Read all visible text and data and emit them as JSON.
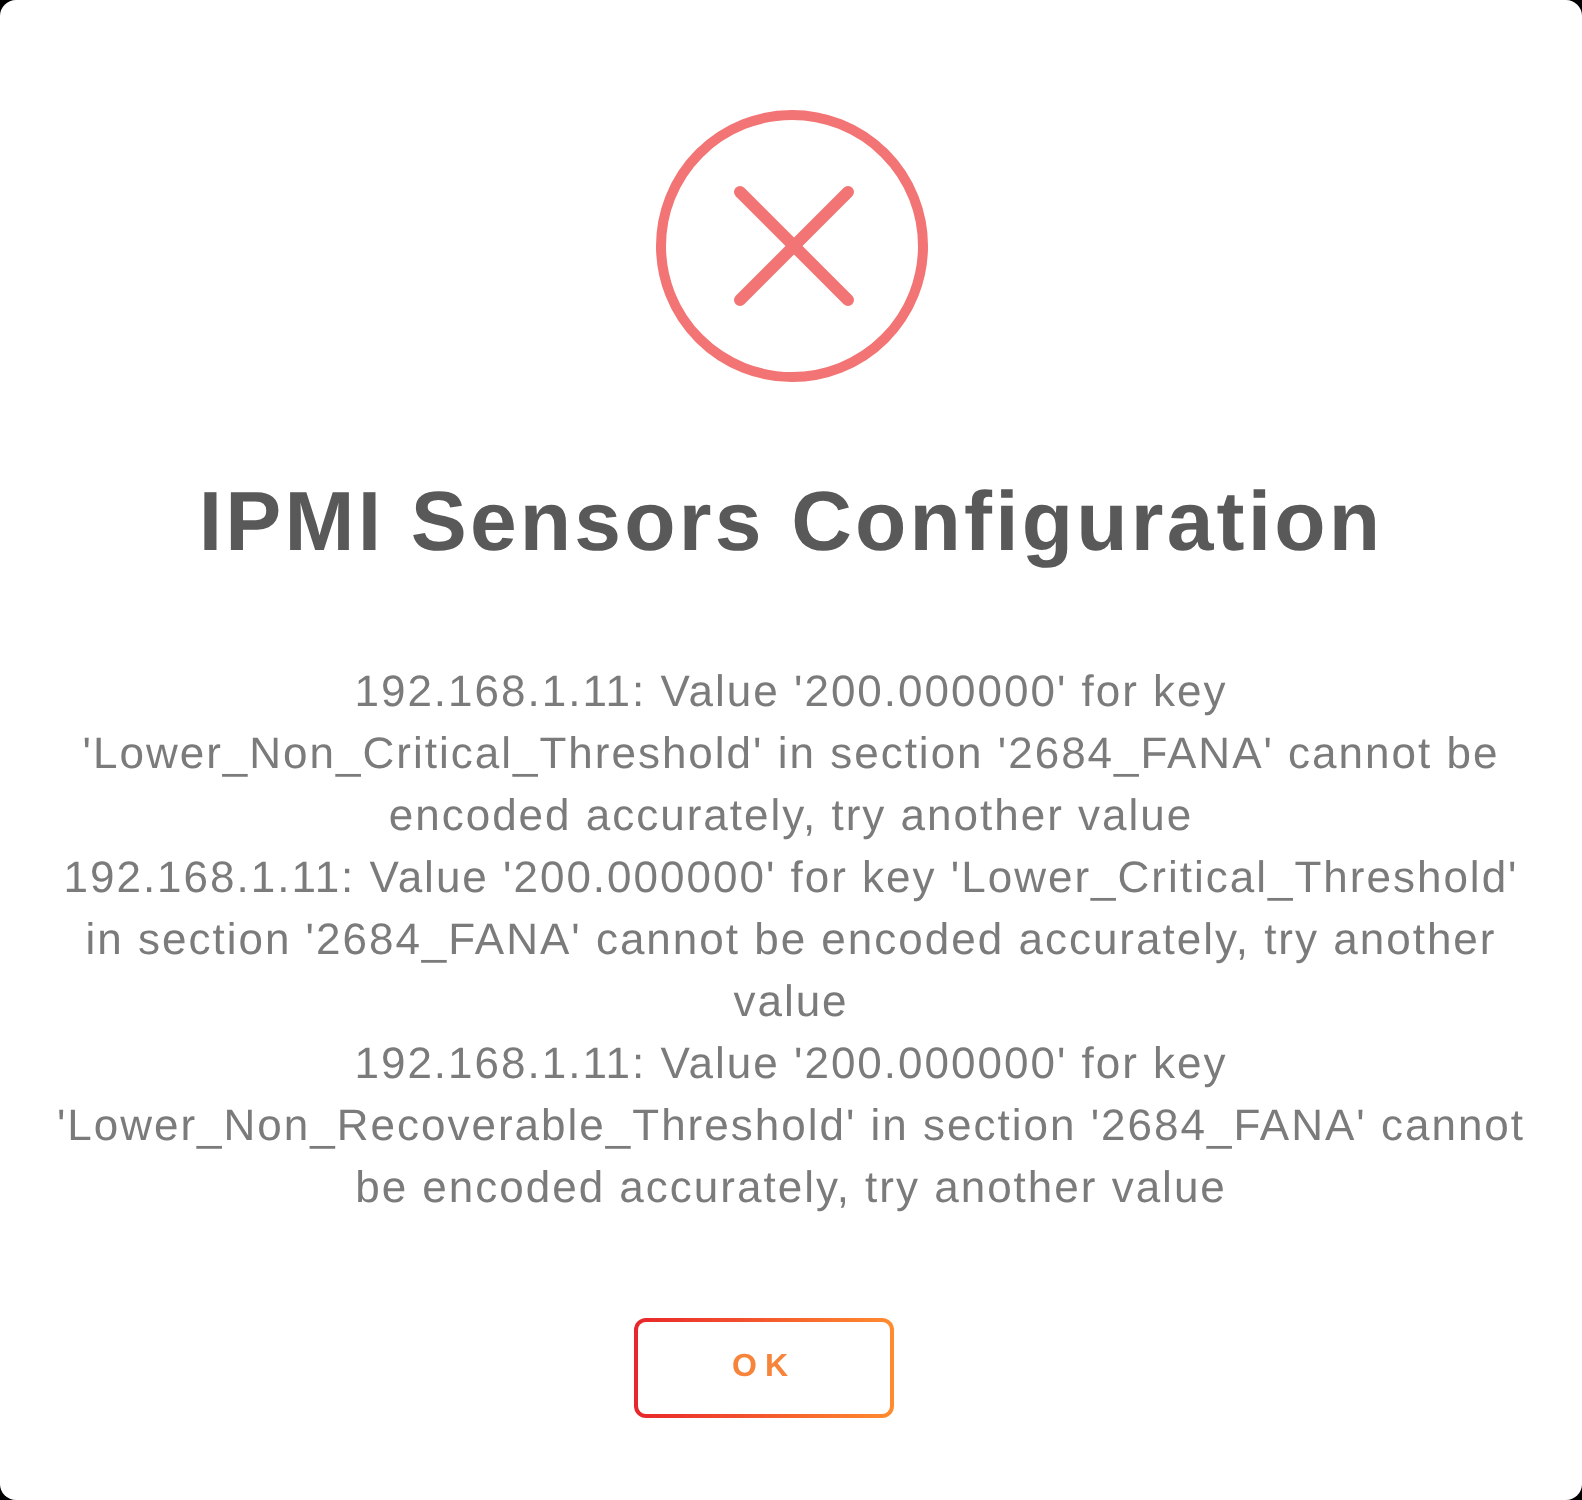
{
  "dialog": {
    "title": "IPMI Sensors Configuration",
    "messages": [
      "192.168.1.11: Value '200.000000' for key 'Lower_Non_Critical_Threshold' in section '2684_FANA' cannot be encoded accurately, try another value",
      "192.168.1.11: Value '200.000000' for key 'Lower_Critical_Threshold' in section '2684_FANA' cannot be encoded accurately, try another value",
      "192.168.1.11: Value '200.000000' for key 'Lower_Non_Recoverable_Threshold' in section '2684_FANA' cannot be encoded accurately, try another value"
    ],
    "buttons": [
      {
        "label": "OK"
      }
    ]
  }
}
